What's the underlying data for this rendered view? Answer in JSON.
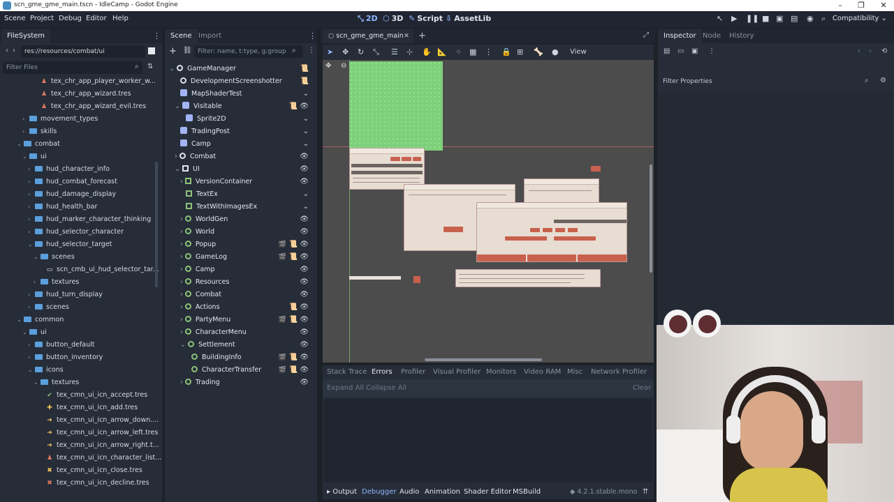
{
  "window": {
    "title": "scn_gme_gme_main.tscn - IdleCamp - Godot Engine"
  },
  "menu": [
    "Scene",
    "Project",
    "Debug",
    "Editor",
    "Help"
  ],
  "modes": [
    "2D",
    "3D",
    "Script",
    "AssetLib"
  ],
  "renderer": "Compatibility",
  "filesystem": {
    "tab": "FileSystem",
    "path": "res://resources/combat/ui",
    "filter_placeholder": "Filter Files",
    "items": [
      "tex_chr_app_player_worker_w...",
      "tex_chr_app_wizard.tres",
      "tex_chr_app_wizard_evil.tres",
      "movement_types",
      "skills",
      "combat",
      "ui",
      "hud_character_info",
      "hud_combat_forecast",
      "hud_damage_display",
      "hud_health_bar",
      "hud_marker_character_thinking",
      "hud_selector_character",
      "hud_selector_target",
      "scenes",
      "scn_cmb_ui_hud_selector_tar...",
      "textures",
      "hud_turn_display",
      "scenes",
      "common",
      "ui",
      "button_default",
      "button_inventory",
      "icons",
      "textures",
      "tex_cmn_ui_icn_accept.tres",
      "tex_cmn_ui_icn_add.tres",
      "tex_cmn_ui_icn_arrow_down....",
      "tex_cmn_ui_icn_arrow_left.tres",
      "tex_cmn_ui_icn_arrow_right.t...",
      "tex_cmn_ui_icn_character_list...",
      "tex_cmn_ui_icn_close.tres",
      "tex_cmn_ui_icn_decline.tres"
    ]
  },
  "scene": {
    "tabs": [
      "Scene",
      "Import"
    ],
    "filter_placeholder": "Filter: name, t:type, g:group",
    "nodes": [
      "GameManager",
      "DevelopmentScreenshotter",
      "MapShaderTest",
      "Visitable",
      "Sprite2D",
      "TradingPost",
      "Camp",
      "Combat",
      "UI",
      "VersionContainer",
      "TextEx",
      "TextWithImagesEx",
      "WorldGen",
      "World",
      "Popup",
      "GameLog",
      "Camp",
      "Resources",
      "Combat",
      "Actions",
      "PartyMenu",
      "CharacterMenu",
      "Settlement",
      "BuildingInfo",
      "CharacterTransfer",
      "Trading"
    ]
  },
  "editor": {
    "scene_tab": "scn_gme_gme_main",
    "view_label": "View"
  },
  "debugger": {
    "tabs": [
      "Stack Trace",
      "Errors",
      "Profiler",
      "Visual Profiler",
      "Monitors",
      "Video RAM",
      "Misc",
      "Network Profiler"
    ],
    "expand": "Expand All",
    "collapse": "Collapse All",
    "clear": "Clear"
  },
  "bottom_tabs": [
    "Output",
    "Debugger",
    "Audio",
    "Animation",
    "Shader Editor",
    "MSBuild"
  ],
  "version": "4.2.1.stable.mono",
  "inspector": {
    "tabs": [
      "Inspector",
      "Node",
      "History"
    ],
    "filter_placeholder": "Filter Properties"
  }
}
